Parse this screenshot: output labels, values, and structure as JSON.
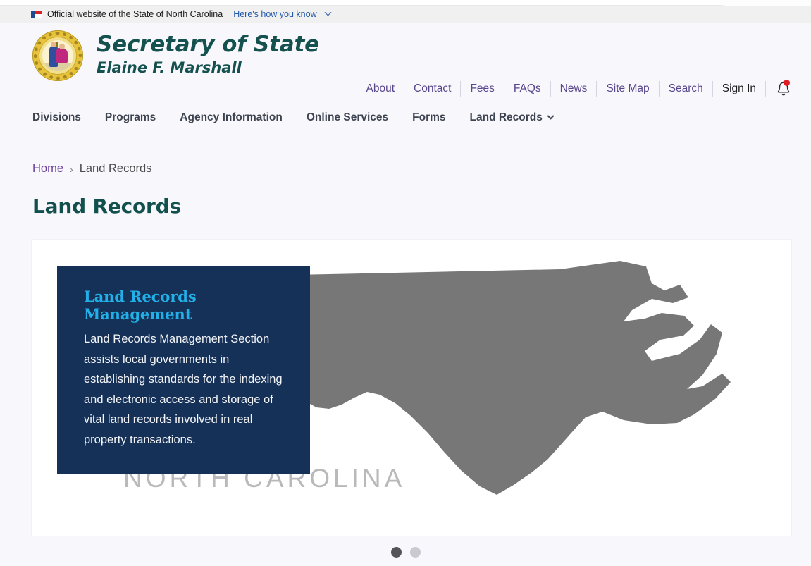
{
  "gov_banner": {
    "flag_icon": "nc-flag-icon",
    "text": "Official website of the State of North Carolina",
    "link_label": "Here's how you know",
    "chevron_icon": "chevron-down-icon"
  },
  "masthead": {
    "seal_icon": "nc-state-seal",
    "title": "Secretary of State",
    "subtitle": "Elaine F. Marshall"
  },
  "utility_nav": {
    "items": [
      {
        "label": "About"
      },
      {
        "label": "Contact"
      },
      {
        "label": "Fees"
      },
      {
        "label": "FAQs"
      },
      {
        "label": "News"
      },
      {
        "label": "Site Map"
      },
      {
        "label": "Search"
      },
      {
        "label": "Sign In"
      }
    ],
    "notification_icon": "bell-icon",
    "notification_badge": true
  },
  "main_nav": {
    "items": [
      {
        "label": "Divisions",
        "has_chevron": false
      },
      {
        "label": "Programs",
        "has_chevron": false
      },
      {
        "label": "Agency Information",
        "has_chevron": false
      },
      {
        "label": "Online Services",
        "has_chevron": false
      },
      {
        "label": "Forms",
        "has_chevron": false
      },
      {
        "label": "Land Records",
        "has_chevron": true
      }
    ]
  },
  "breadcrumb": {
    "home": "Home",
    "separator": "›",
    "current": "Land Records"
  },
  "page_title": "Land Records",
  "hero": {
    "card": {
      "heading": "Land Records Management",
      "body": "Land Records Management Section assists local governments in establishing standards for the indexing and electronic access and storage of vital land records involved in real property transactions."
    },
    "map_label": "NORTH CAROLINA",
    "map_icon": "north-carolina-map",
    "carousel": {
      "dots": [
        {
          "active": true
        },
        {
          "active": false
        }
      ]
    }
  },
  "colors": {
    "brand_teal": "#14514f",
    "card_navy": "#163158",
    "card_heading_cyan": "#22b0e8",
    "link_purple": "#58468c",
    "banner_gray": "#f0f0f0",
    "page_bg": "#f8f7fc",
    "map_gray": "#777777",
    "badge_red": "#e01b24"
  }
}
